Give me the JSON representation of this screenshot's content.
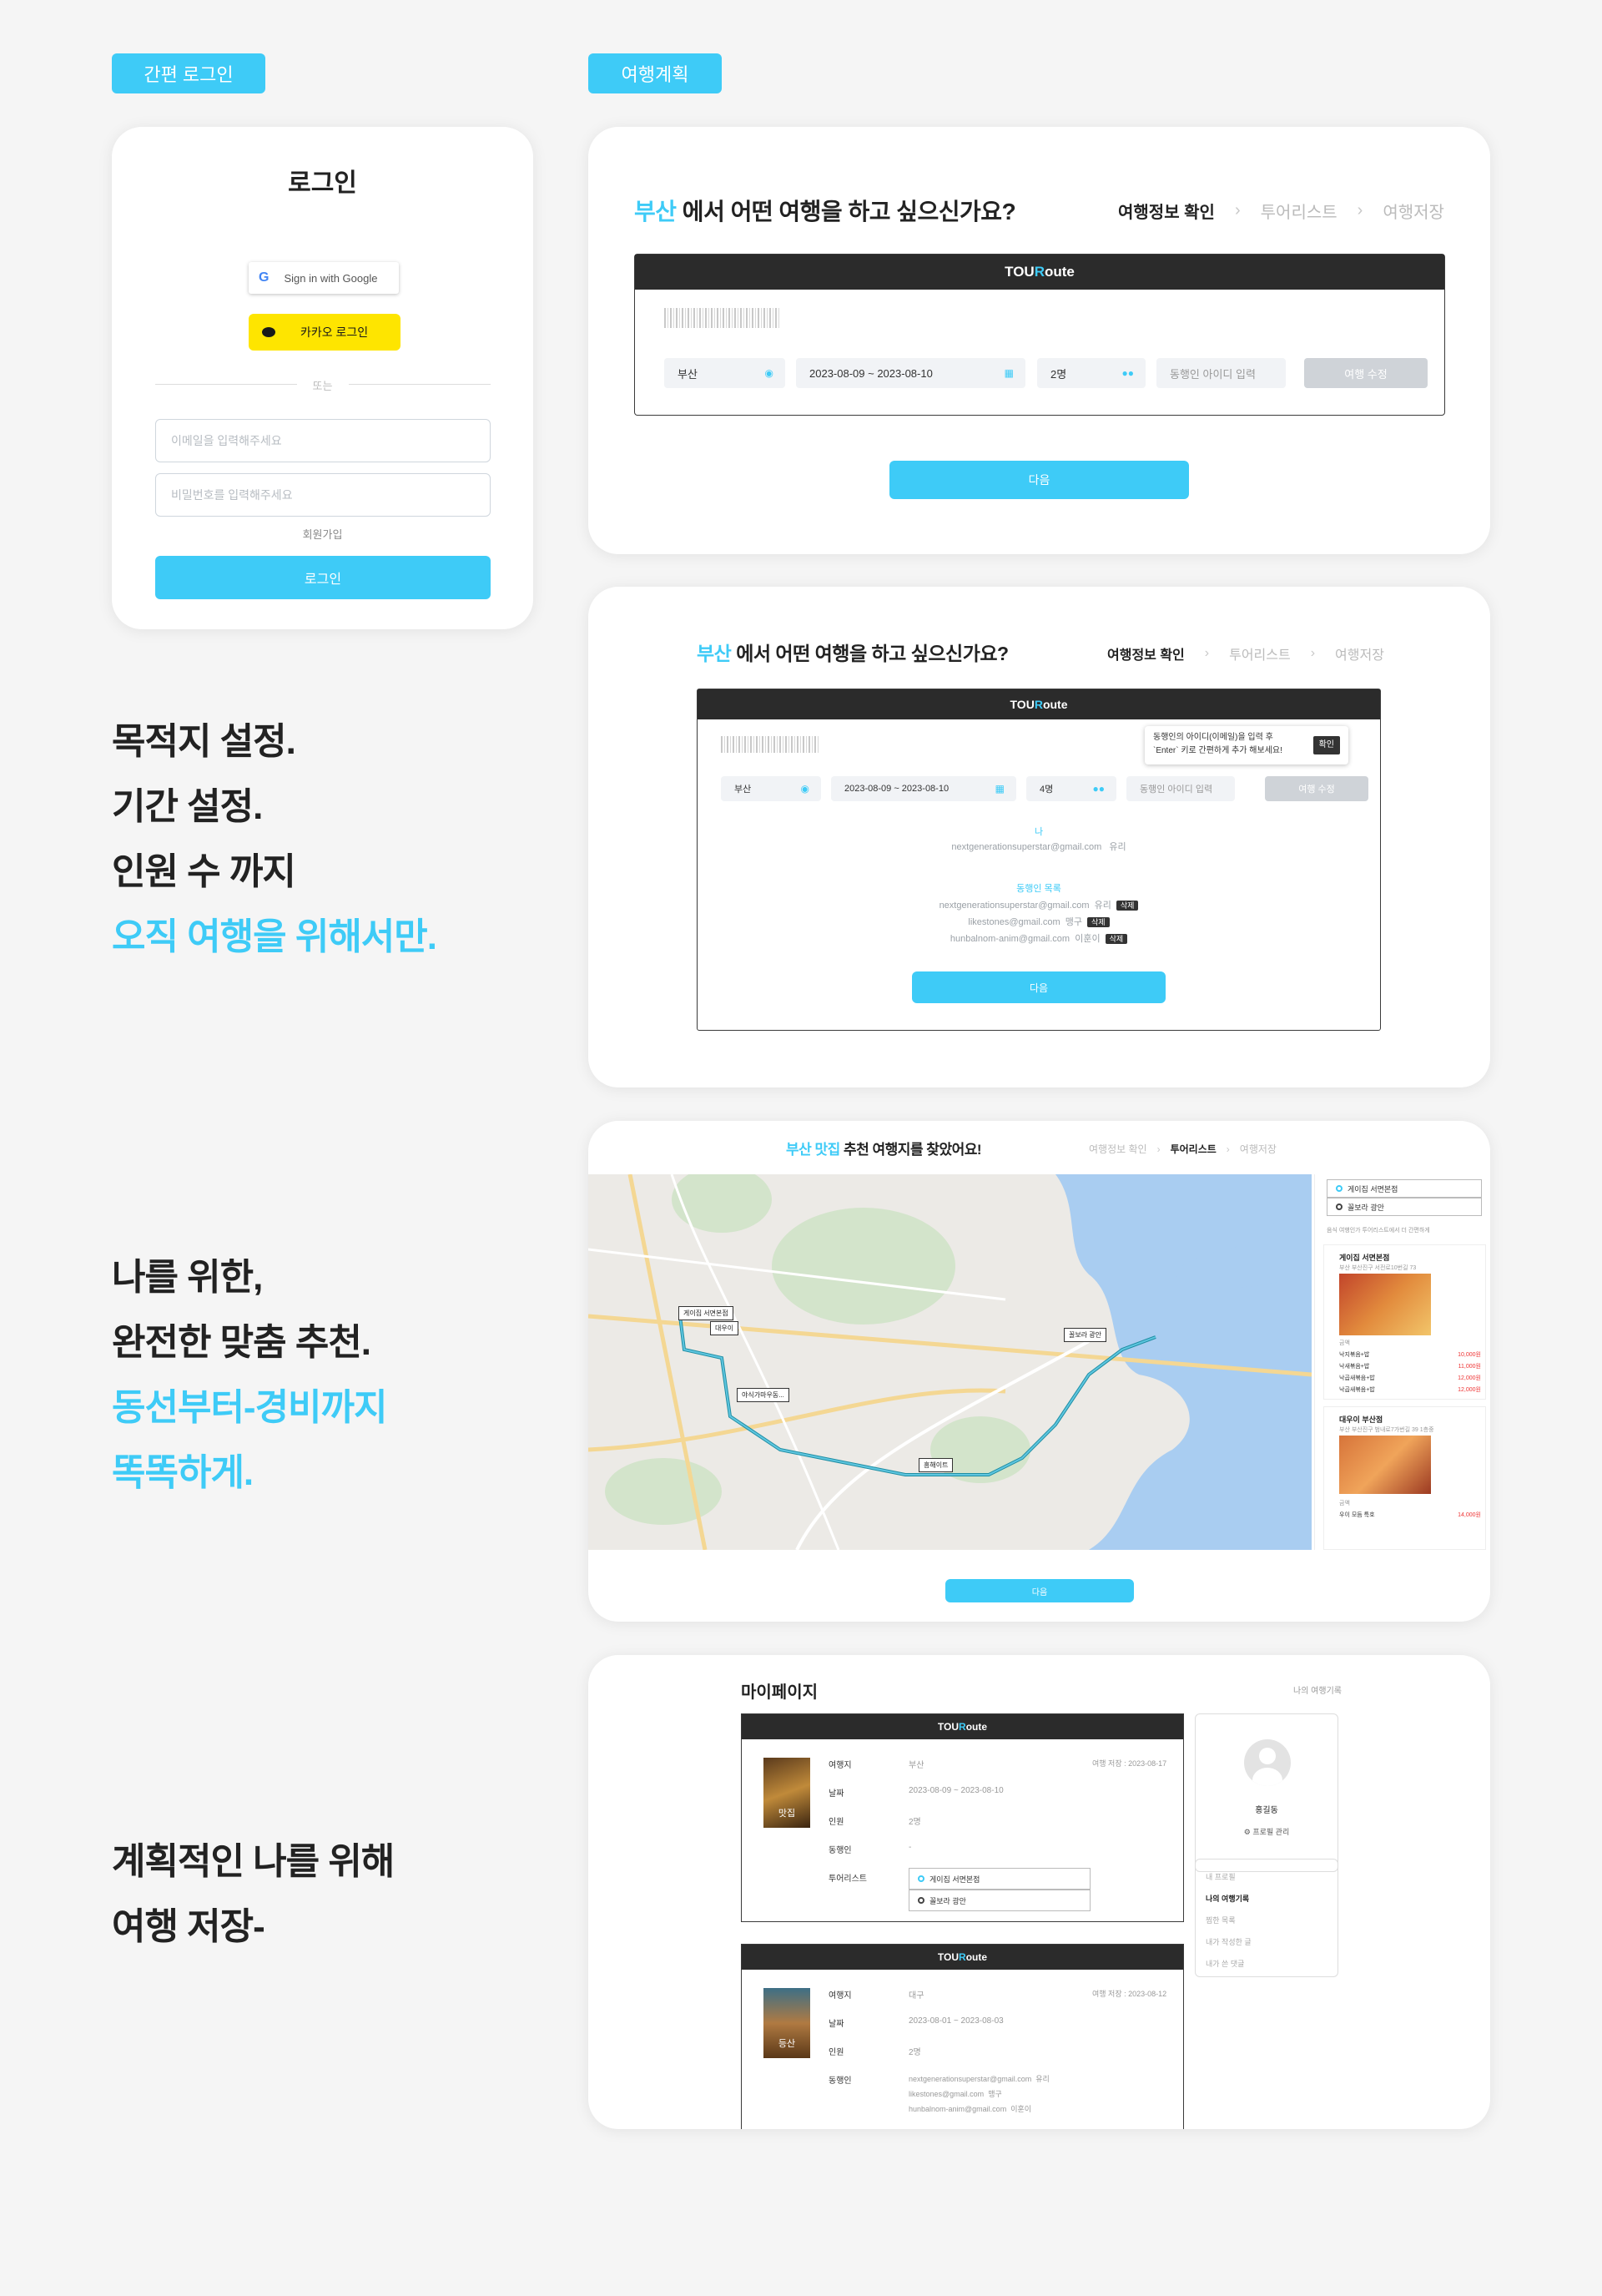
{
  "labels": {
    "simple_login": "간편 로그인",
    "trip_plan": "여행계획"
  },
  "login": {
    "title": "로그인",
    "google": "Sign in with Google",
    "kakao": "카카오 로그인",
    "or": "또는",
    "email_placeholder": "이메일을 입력해주세요",
    "password_placeholder": "비밀번호를 입력해주세요",
    "signup": "회원가입",
    "submit": "로그인"
  },
  "taglines": {
    "t1": {
      "line1": "목적지 설정.",
      "line2": "기간 설정.",
      "line3": "인원 수 까지",
      "line4": "오직 여행을 위해서만."
    },
    "t2": {
      "line1": "나를 위한,",
      "line2": "완전한 맞춤 추천.",
      "line3": "동선부터-경비까지",
      "line4": "똑똑하게."
    },
    "t3": {
      "line1": "계획적인 나를 위해",
      "line2": "여행 저장-"
    }
  },
  "brand": {
    "logo_a": "TOU",
    "logo_b": "R",
    "logo_c": "oute"
  },
  "steps": {
    "s1": "여행정보 확인",
    "s2": "투어리스트",
    "s3": "여행저장",
    "sep": "›"
  },
  "plan1": {
    "city": "부산",
    "question": " 에서 어떤 여행을 하고 싶으신가요?",
    "dest": "부산",
    "dates": "2023-08-09  ~  2023-08-10",
    "people": "2명",
    "companion_placeholder": "동행인 아이디 입력",
    "edit": "여행 수정",
    "next": "다음"
  },
  "plan2": {
    "city": "부산",
    "question": " 에서 어떤 여행을 하고 싶으신가요?",
    "dest": "부산",
    "dates": "2023-08-09  ~  2023-08-10",
    "people": "4명",
    "companion_placeholder": "동행인 아이디 입력",
    "edit": "여행 수정",
    "tooltip_l1": "동행인의 아이디(이메일)을 입력 후",
    "tooltip_l2": "`Enter` 키로 간편하게 추가 해보세요!",
    "tooltip_ok": "확인",
    "me_label": "나",
    "me_email": "nextgenerationsuperstar@gmail.com",
    "me_name": "유리",
    "list_label": "동행인 목록",
    "delete": "삭제",
    "companions": [
      {
        "email": "nextgenerationsuperstar@gmail.com",
        "name": "유리"
      },
      {
        "email": "likestones@gmail.com",
        "name": "맹구"
      },
      {
        "email": "hunbalnom-anim@gmail.com",
        "name": "이훈이"
      }
    ],
    "next": "다음"
  },
  "plan3": {
    "city": "부산 맛집",
    "question": " 추천 여행지를 찾았어요!",
    "next": "다음",
    "selected": [
      "게이집 서면본점",
      "꼴보라 광안"
    ],
    "side_note": "음식 여행인가 투어리스트에서 더 간편하게",
    "places": [
      {
        "name": "게이집 서면본점",
        "addr": "부산 부산진구 서전로10번길 73",
        "section": "금액",
        "items": [
          {
            "name": "낙지볶음+밥",
            "price": "10,000원"
          },
          {
            "name": "낙새볶음+밥",
            "price": "11,000원"
          },
          {
            "name": "낙곱새볶음+밥",
            "price": "12,000원"
          },
          {
            "name": "낙곱새볶음+밥",
            "price": "12,000원"
          }
        ]
      },
      {
        "name": "대우이 부산점",
        "addr": "부산 부산진구 범내로7가번길 39 1층중",
        "section": "금액",
        "items": [
          {
            "name": "우이 모듬 특호",
            "price": "14,000원"
          }
        ]
      }
    ],
    "map_pins": [
      "게이집 서면본점",
      "대우이",
      "야식가마우동...",
      "꼴보라 광안",
      "흥해이트"
    ]
  },
  "mypage": {
    "title": "마이페이지",
    "subtitle": "나의 여행기록",
    "fields": {
      "dest": "여행지",
      "date": "날짜",
      "people": "인원",
      "companion": "동행인",
      "tourlist": "투어리스트"
    },
    "trip1": {
      "badge": "맛집",
      "created": "여행 저장 : 2023-08-17",
      "dest": "부산",
      "date": "2023-08-09 ~ 2023-08-10",
      "people": "2명",
      "companion": "-",
      "tours": [
        "게이집 서면본점",
        "꼴보라 광안"
      ]
    },
    "trip2": {
      "badge": "등산",
      "created": "여행 저장 : 2023-08-12",
      "dest": "대구",
      "date": "2023-08-01 ~ 2023-08-03",
      "people": "2명",
      "companions": [
        {
          "email": "nextgenerationsuperstar@gmail.com",
          "name": "유리"
        },
        {
          "email": "likestones@gmail.com",
          "name": "맹구"
        },
        {
          "email": "hunbalnom-anim@gmail.com",
          "name": "이훈이"
        }
      ]
    },
    "profile_name": "홍길동",
    "profile_manage": "프로필 관리",
    "menu": [
      "내 프로필",
      "나의 여행기록",
      "찜한 목록",
      "내가 작성한 글",
      "내가 쓴 댓글"
    ]
  },
  "colors": {
    "accent": "#3ecbf7",
    "kakao": "#fee500",
    "dark": "#2b2b2b"
  }
}
